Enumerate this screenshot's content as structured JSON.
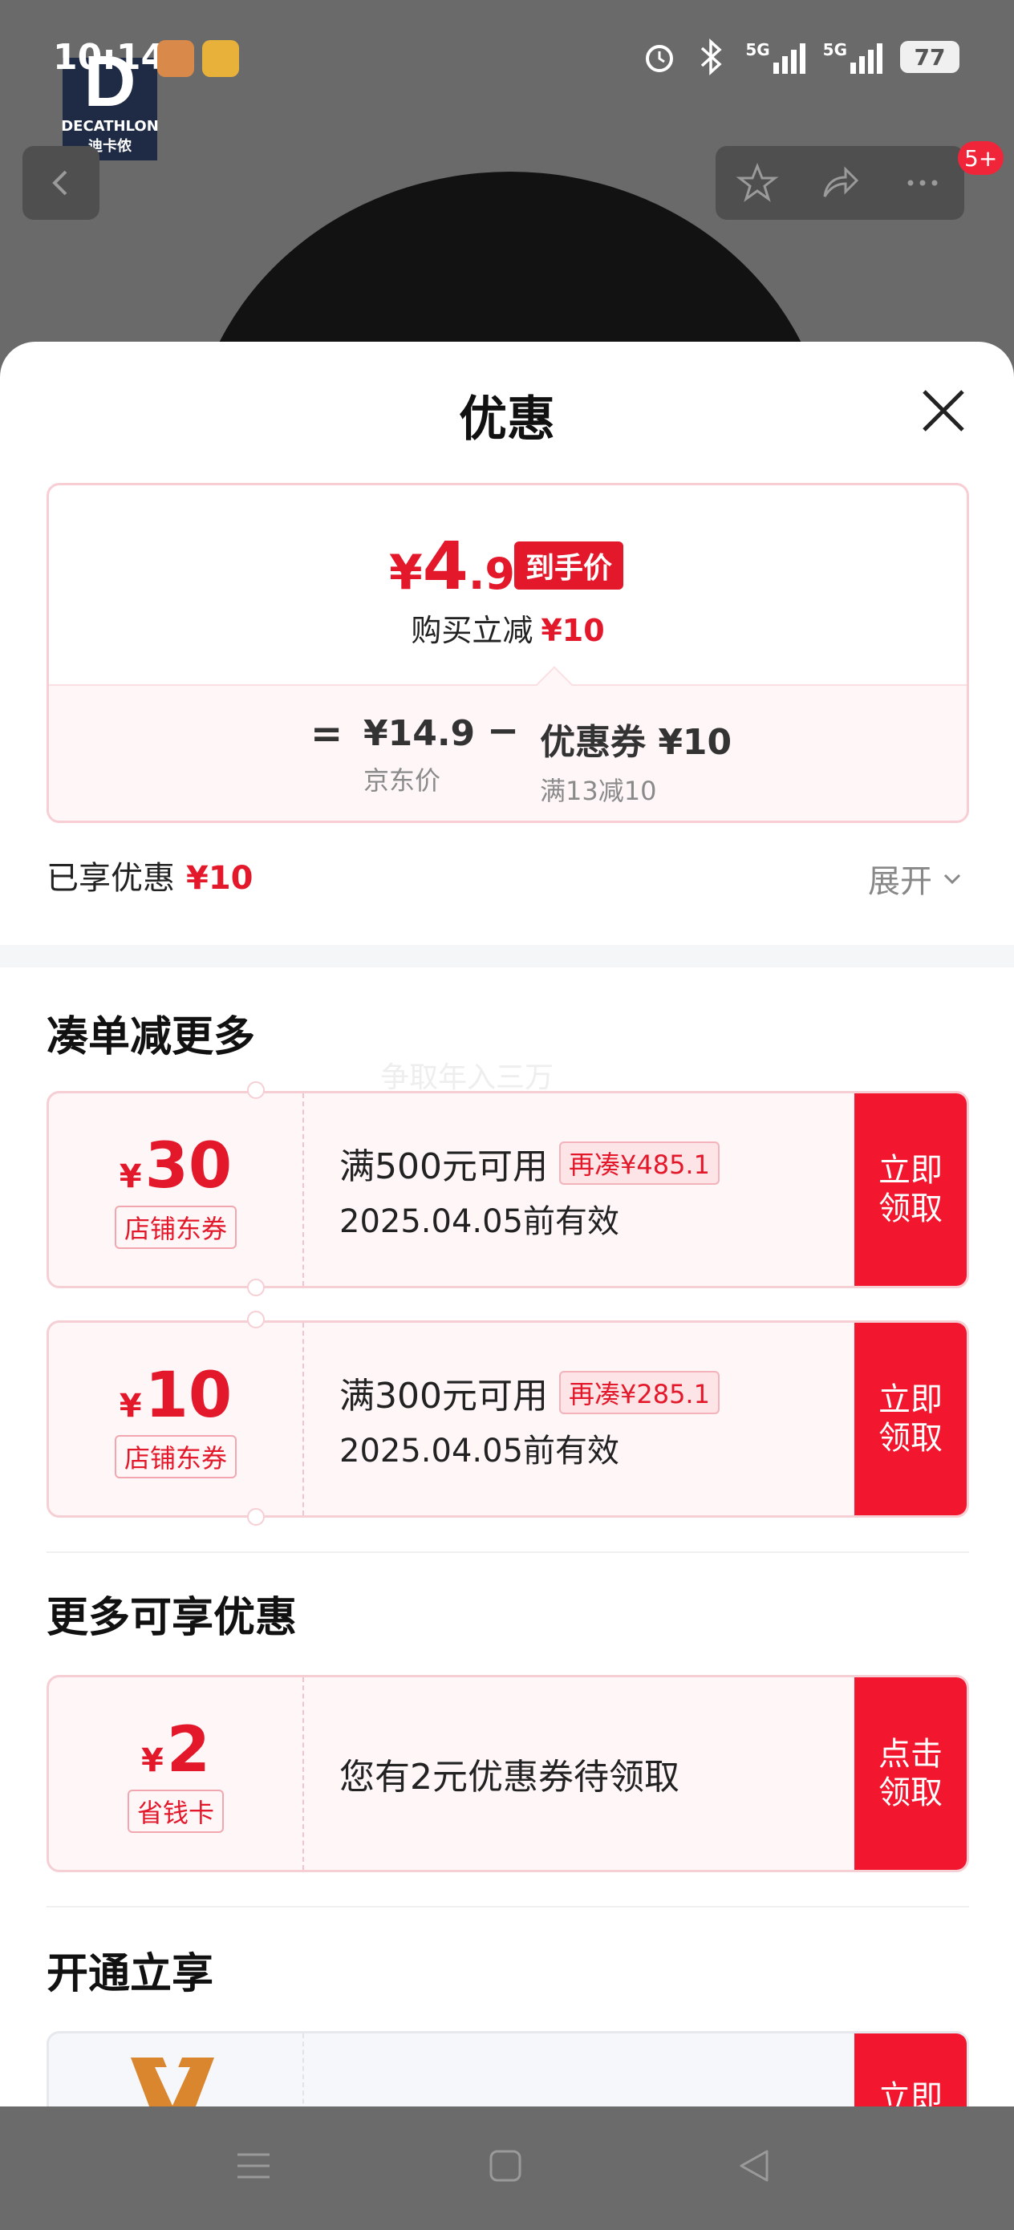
{
  "status_bar": {
    "time": "10:14",
    "signal_1": "5G",
    "signal_2": "5G",
    "battery": "77"
  },
  "background": {
    "brand_logo_text": "DECATHLON",
    "brand_logo_sub": "迪卡侬",
    "message_badge": "5+"
  },
  "sheet": {
    "title": "优惠",
    "price_card": {
      "currency": "¥",
      "final_int": "4",
      "final_dec": ".9",
      "final_tag": "到手价",
      "reduce_label": "购买立减",
      "reduce_amount": "¥10",
      "equals": "=",
      "jd_price": "¥14.9",
      "jd_price_label": "京东价",
      "minus": "−",
      "coupon_value": "优惠券 ¥10",
      "coupon_rule": "满13减10"
    },
    "enjoyed_label": "已享优惠",
    "enjoyed_amount": "¥10",
    "expand_label": "展开",
    "section_more": "凑单减更多",
    "watermark": "争取年入三万",
    "coupons": [
      {
        "currency": "¥",
        "amount": "30",
        "type": "店铺东券",
        "condition": "满500元可用",
        "more": "再凑¥485.1",
        "valid": "2025.04.05前有效",
        "button_line1": "立即",
        "button_line2": "领取"
      },
      {
        "currency": "¥",
        "amount": "10",
        "type": "店铺东券",
        "condition": "满300元可用",
        "more": "再凑¥285.1",
        "valid": "2025.04.05前有效",
        "button_line1": "立即",
        "button_line2": "领取"
      }
    ],
    "section_extra": "更多可享优惠",
    "saving_card": {
      "currency": "¥",
      "amount": "2",
      "type": "省钱卡",
      "text": "您有2元优惠券待领取",
      "button_line1": "点击",
      "button_line2": "领取"
    },
    "section_open": "开通立享",
    "open_card": {
      "button_line1": "立即"
    }
  },
  "colors": {
    "accent_red": "#e3182a",
    "button_red": "#f2172e",
    "overlay": "#6b6b6b"
  }
}
